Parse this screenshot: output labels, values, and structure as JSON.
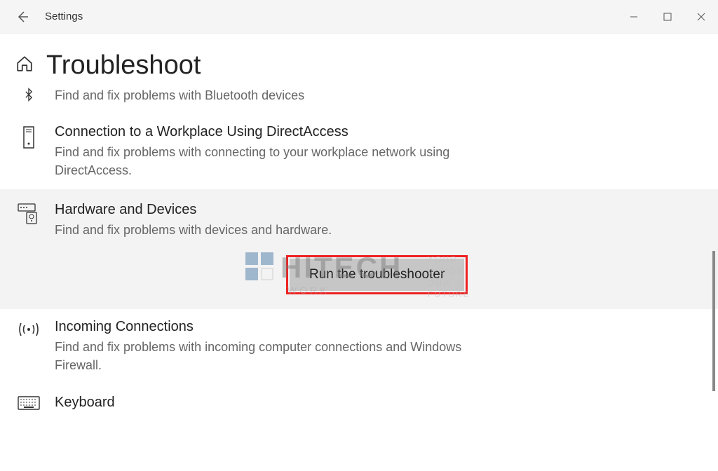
{
  "window": {
    "app_title": "Settings"
  },
  "page": {
    "title": "Troubleshoot"
  },
  "items": {
    "bluetooth": {
      "desc": "Find and fix problems with Bluetooth devices"
    },
    "direct": {
      "title": "Connection to a Workplace Using DirectAccess",
      "desc": "Find and fix problems with connecting to your workplace network using DirectAccess."
    },
    "hardware": {
      "title": "Hardware and Devices",
      "desc": "Find and fix problems with devices and hardware.",
      "run_label": "Run the troubleshooter"
    },
    "incoming": {
      "title": "Incoming Connections",
      "desc": "Find and fix problems with incoming computer connections and Windows Firewall."
    },
    "keyboard": {
      "title": "Keyboard"
    }
  },
  "watermark": {
    "brand": "HITECH",
    "sub": "WORK",
    "tag1": "YOUR VISION",
    "tag2": "OUR FUTURE"
  }
}
